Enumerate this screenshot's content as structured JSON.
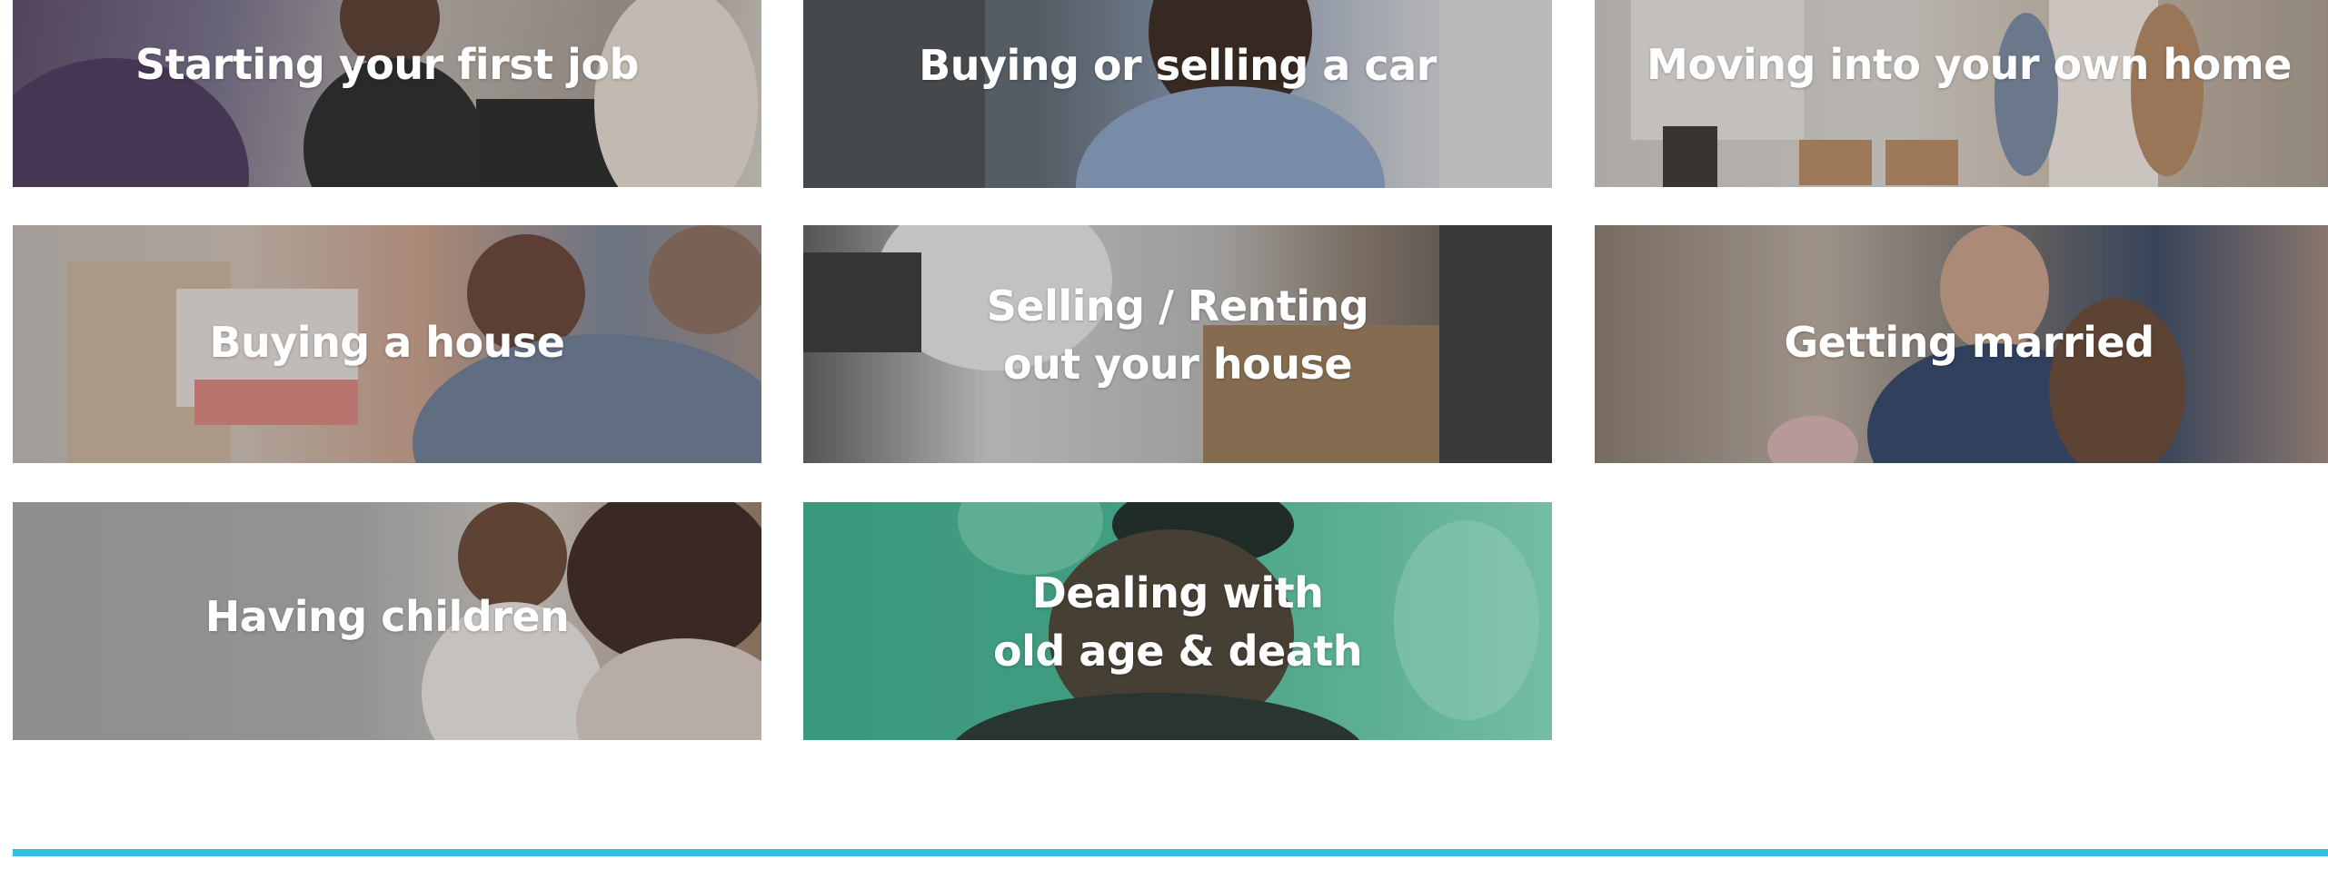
{
  "tiles": [
    {
      "label": "Starting your first job"
    },
    {
      "label": "Buying or selling a car"
    },
    {
      "label": "Moving into your own home"
    },
    {
      "label": "Buying a house"
    },
    {
      "label": "Selling / Renting\nout your house"
    },
    {
      "label": "Getting married"
    },
    {
      "label": "Having children"
    },
    {
      "label": "Dealing with\nold age & death"
    }
  ],
  "colors": {
    "accent_bar": "#2cc3e6",
    "tile_text": "#ffffff",
    "dealing_tile_teal": "#45a086"
  }
}
